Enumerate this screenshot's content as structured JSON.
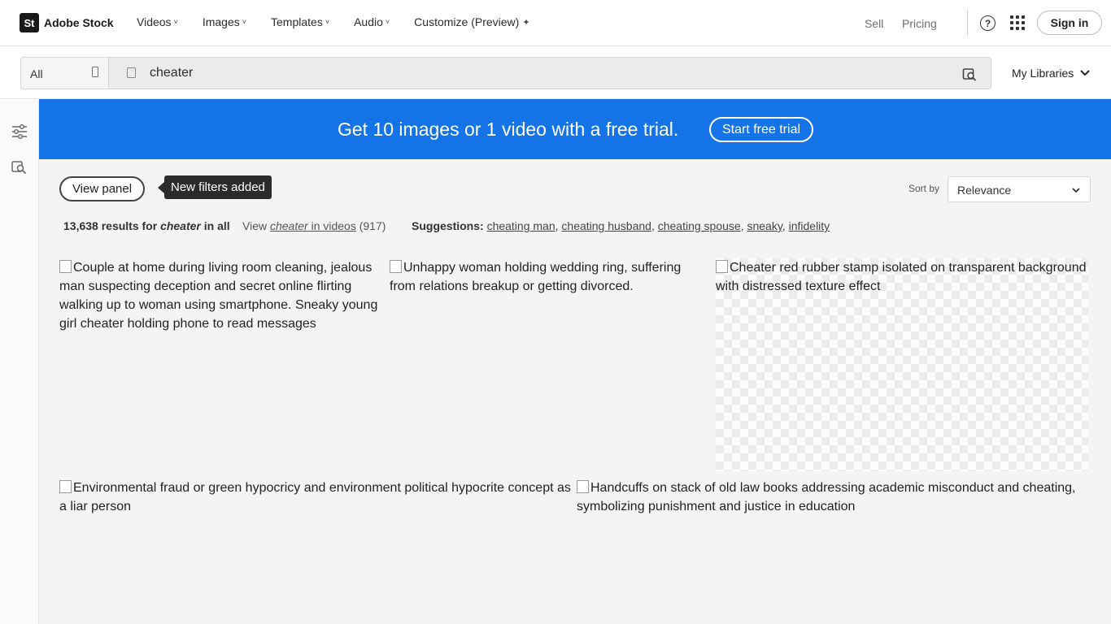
{
  "brand": {
    "logo_mark": "St",
    "name": "Adobe Stock"
  },
  "nav": {
    "items": [
      {
        "label": "Videos",
        "caret": "˅"
      },
      {
        "label": "Images",
        "caret": "˅"
      },
      {
        "label": "Templates",
        "caret": "˅"
      },
      {
        "label": "Audio",
        "caret": "˅"
      },
      {
        "label": "Customize (Preview)",
        "caret": "✦"
      }
    ],
    "sell": "Sell",
    "pricing": "Pricing",
    "help_icon": "?",
    "signin": "Sign in"
  },
  "search": {
    "scope": "All",
    "query": "cheater",
    "my_libraries": "My Libraries"
  },
  "banner": {
    "text": "Get 10 images or 1 video with a free trial.",
    "button": "Start free trial",
    "bg_color": "#1473e6"
  },
  "toolbar": {
    "view_panel": "View panel",
    "tooltip": "New filters added",
    "sort_by_label": "Sort by",
    "sort_value": "Relevance"
  },
  "results": {
    "count": "13,638 results for",
    "query": "cheater",
    "scope_text": "in all",
    "view_prefix": "View",
    "view_query": "cheater",
    "view_suffix": "in videos",
    "view_count": "(917)",
    "suggestions_label": "Suggestions:",
    "suggestions": [
      "cheating man",
      "cheating husband",
      "cheating spouse",
      "sneaky",
      "infidelity"
    ]
  },
  "tiles": [
    {
      "alt": "Couple at home during living room cleaning, jealous man suspecting deception and secret online flirting walking up to woman using smartphone. Sneaky young girl cheater holding phone to read messages"
    },
    {
      "alt": "Unhappy woman holding wedding ring, suffering from relations breakup or getting divorced."
    },
    {
      "alt": "Cheater red rubber stamp isolated on transparent background with distressed texture effect"
    },
    {
      "alt": "Environmental fraud or green hypocricy and environment political hypocrite concept as a liar person"
    },
    {
      "alt": "Handcuffs on stack of old law books addressing academic misconduct and cheating, symbolizing punishment and justice in education"
    }
  ]
}
